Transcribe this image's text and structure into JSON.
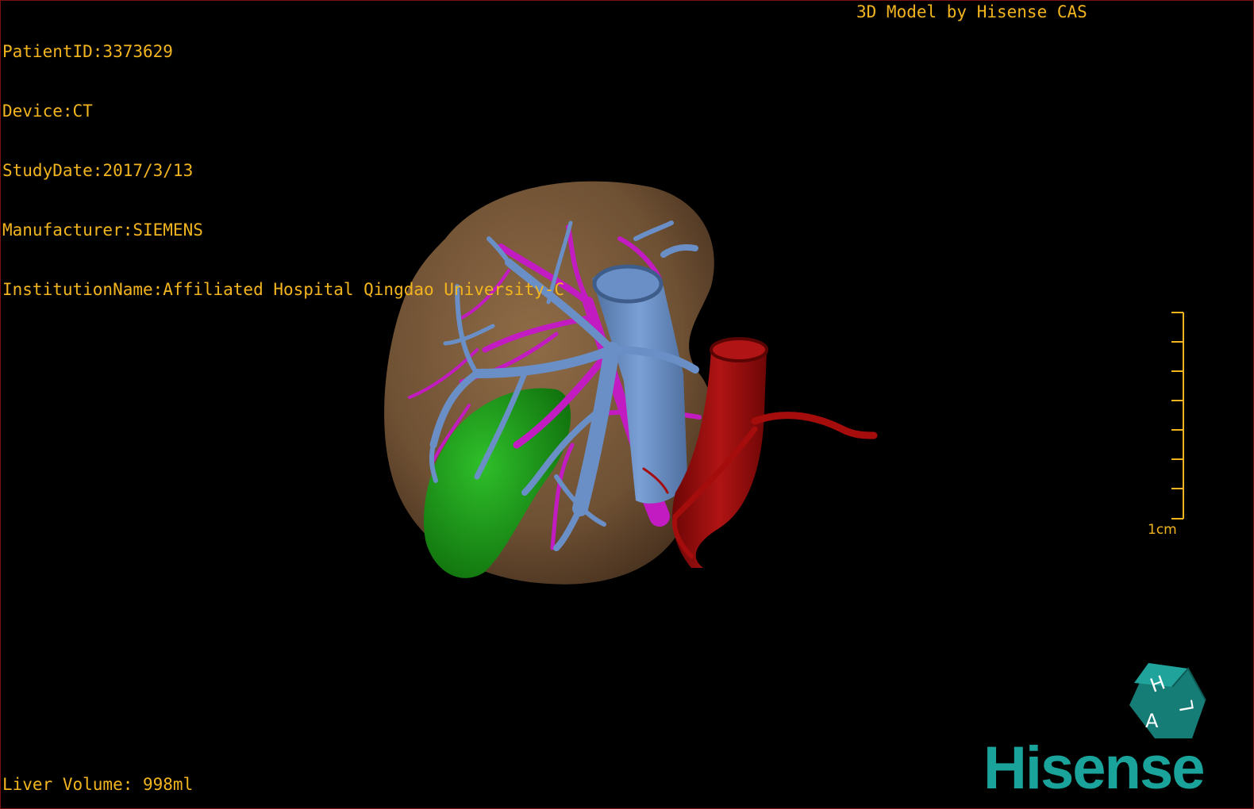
{
  "overlay": {
    "patient_id": "PatientID:3373629",
    "device": "Device:CT",
    "study_date": "StudyDate:2017/3/13",
    "manufacturer": "Manufacturer:SIEMENS",
    "institution": "InstitutionName:Affiliated Hospital Qingdao University-C",
    "credit": "3D Model by Hisense CAS",
    "liver_volume": "Liver Volume: 998ml"
  },
  "scale": {
    "label": "1cm",
    "ticks": 8
  },
  "orientation_cube": {
    "letters": [
      "H",
      "A",
      "L"
    ]
  },
  "brand": {
    "logo_text": "Hisense",
    "color": "#1aa39a"
  },
  "colors": {
    "overlay_text": "#f3b51f",
    "liver": "#7a5a3a",
    "portal_vein": "#6a8fc7",
    "hepatic_vein": "#c21bc2",
    "gallbladder": "#1f9a1a",
    "artery": "#a50d0d",
    "viewport_border": "#7a1010"
  }
}
